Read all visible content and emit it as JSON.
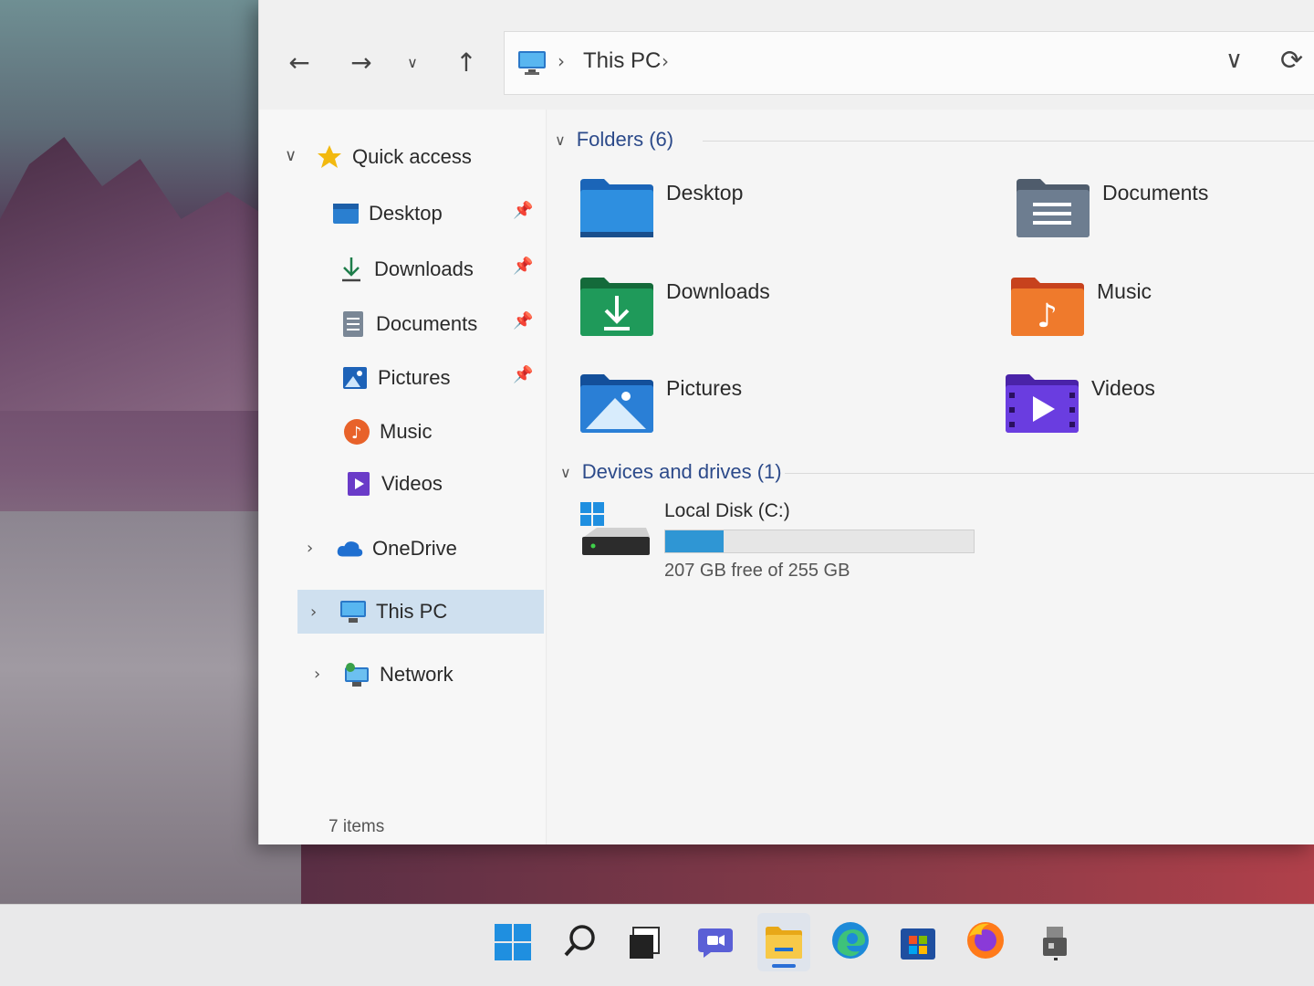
{
  "toolbar": {
    "back_icon": "arrow-left-icon",
    "forward_icon": "arrow-right-icon",
    "recent_icon": "chevron-down-icon",
    "up_icon": "arrow-up-icon",
    "address_location": "This PC",
    "address_dropdown_icon": "chevron-down-icon",
    "refresh_icon": "refresh-icon"
  },
  "sidebar": {
    "quick_access": "Quick access",
    "items": [
      {
        "label": "Desktop",
        "pinned": true
      },
      {
        "label": "Downloads",
        "pinned": true
      },
      {
        "label": "Documents",
        "pinned": true
      },
      {
        "label": "Pictures",
        "pinned": true
      },
      {
        "label": "Music",
        "pinned": false
      },
      {
        "label": "Videos",
        "pinned": false
      }
    ],
    "onedrive": "OneDrive",
    "this_pc": "This PC",
    "network": "Network",
    "status": "7 items"
  },
  "content": {
    "folders_header": "Folders (6)",
    "folders": [
      {
        "label": "Desktop"
      },
      {
        "label": "Documents"
      },
      {
        "label": "Downloads"
      },
      {
        "label": "Music"
      },
      {
        "label": "Pictures"
      },
      {
        "label": "Videos"
      }
    ],
    "devices_header": "Devices and drives (1)",
    "drive": {
      "name": "Local Disk (C:)",
      "free_text": "207 GB free of 255 GB",
      "used_fraction": 0.19
    }
  },
  "taskbar": {
    "icons": [
      "start-icon",
      "search-icon",
      "task-view-icon",
      "chat-icon",
      "file-explorer-icon",
      "edge-icon",
      "store-icon",
      "firefox-icon",
      "usb-drive-icon"
    ]
  },
  "colors": {
    "accent": "#2f96d4",
    "selection": "#cfe0ef",
    "header_text": "#2c4a8a"
  }
}
